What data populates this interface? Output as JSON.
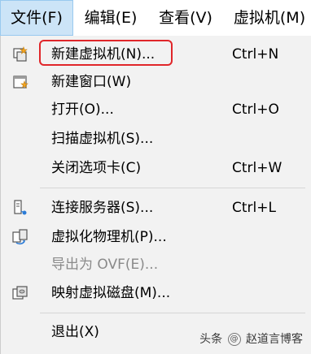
{
  "menubar": {
    "items": [
      {
        "label": "文件(F)",
        "active": true
      },
      {
        "label": "编辑(E)"
      },
      {
        "label": "查看(V)"
      },
      {
        "label": "虚拟机(M)"
      }
    ]
  },
  "file_menu": {
    "items": [
      {
        "label": "新建虚拟机(N)...",
        "shortcut": "Ctrl+N",
        "icon": "new-vm-icon",
        "highlighted": true
      },
      {
        "label": "新建窗口(W)",
        "shortcut": "",
        "icon": "new-window-icon"
      },
      {
        "label": "打开(O)...",
        "shortcut": "Ctrl+O"
      },
      {
        "label": "扫描虚拟机(S)...",
        "shortcut": ""
      },
      {
        "label": "关闭选项卡(C)",
        "shortcut": "Ctrl+W"
      },
      {
        "label": "连接服务器(S)...",
        "shortcut": "Ctrl+L",
        "icon": "connect-server-icon"
      },
      {
        "label": "虚拟化物理机(P)...",
        "shortcut": "",
        "icon": "virtualize-physical-icon"
      },
      {
        "label": "导出为 OVF(E)...",
        "shortcut": "",
        "disabled": true
      },
      {
        "label": "映射虚拟磁盘(M)...",
        "shortcut": "",
        "icon": "map-disk-icon"
      },
      {
        "label": "退出(X)",
        "shortcut": ""
      }
    ]
  },
  "highlight_color": "#e0262a",
  "watermark": {
    "prefix": "头条",
    "at": "@",
    "author": "赵道言博客"
  }
}
